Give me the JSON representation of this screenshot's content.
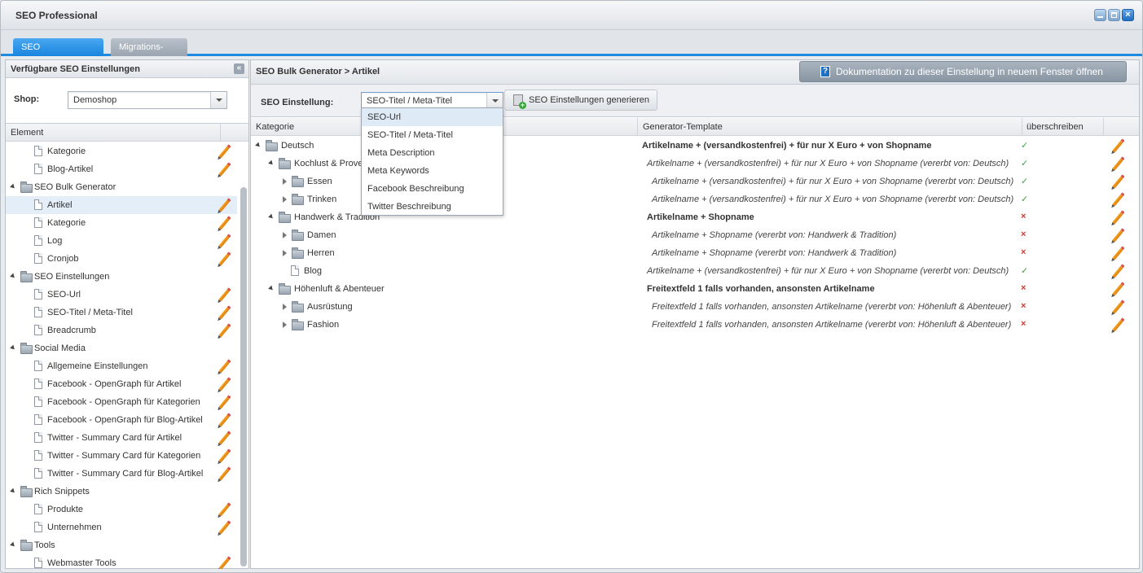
{
  "window": {
    "title": "SEO Professional"
  },
  "tabs": [
    {
      "label": "SEO Einstellungen",
      "active": true
    },
    {
      "label": "Migrations-Tool",
      "active": false
    }
  ],
  "left_panel": {
    "header": "Verfügbare SEO Einstellungen",
    "shop_label": "Shop:",
    "shop_value": "Demoshop",
    "column_header": "Element",
    "tree": [
      {
        "label": "Kategorie",
        "type": "file",
        "level": 2,
        "editable": true
      },
      {
        "label": "Blog-Artikel",
        "type": "file",
        "level": 2,
        "editable": true
      },
      {
        "label": "SEO Bulk Generator",
        "type": "folder",
        "level": 1,
        "editable": false
      },
      {
        "label": "Artikel",
        "type": "file",
        "level": 2,
        "editable": true,
        "selected": true
      },
      {
        "label": "Kategorie",
        "type": "file",
        "level": 2,
        "editable": true
      },
      {
        "label": "Log",
        "type": "file",
        "level": 2,
        "editable": true
      },
      {
        "label": "Cronjob",
        "type": "file",
        "level": 2,
        "editable": true
      },
      {
        "label": "SEO Einstellungen",
        "type": "folder",
        "level": 1,
        "editable": false
      },
      {
        "label": "SEO-Url",
        "type": "file",
        "level": 2,
        "editable": true
      },
      {
        "label": "SEO-Titel / Meta-Titel",
        "type": "file",
        "level": 2,
        "editable": true
      },
      {
        "label": "Breadcrumb",
        "type": "file",
        "level": 2,
        "editable": true
      },
      {
        "label": "Social Media",
        "type": "folder",
        "level": 1,
        "editable": false
      },
      {
        "label": "Allgemeine Einstellungen",
        "type": "file",
        "level": 2,
        "editable": true
      },
      {
        "label": "Facebook - OpenGraph für Artikel",
        "type": "file",
        "level": 2,
        "editable": true
      },
      {
        "label": "Facebook - OpenGraph für Kategorien",
        "type": "file",
        "level": 2,
        "editable": true
      },
      {
        "label": "Facebook - OpenGraph für Blog-Artikel",
        "type": "file",
        "level": 2,
        "editable": true
      },
      {
        "label": "Twitter - Summary Card für Artikel",
        "type": "file",
        "level": 2,
        "editable": true
      },
      {
        "label": "Twitter - Summary Card für Kategorien",
        "type": "file",
        "level": 2,
        "editable": true
      },
      {
        "label": "Twitter - Summary Card für Blog-Artikel",
        "type": "file",
        "level": 2,
        "editable": true
      },
      {
        "label": "Rich Snippets",
        "type": "folder",
        "level": 1,
        "editable": false
      },
      {
        "label": "Produkte",
        "type": "file",
        "level": 2,
        "editable": true
      },
      {
        "label": "Unternehmen",
        "type": "file",
        "level": 2,
        "editable": true
      },
      {
        "label": "Tools",
        "type": "folder",
        "level": 1,
        "editable": false
      },
      {
        "label": "Webmaster Tools",
        "type": "file",
        "level": 2,
        "editable": true
      }
    ]
  },
  "right_panel": {
    "breadcrumb": "SEO Bulk Generator > Artikel",
    "doc_button": "Dokumentation zu dieser Einstellung in neuem Fenster öffnen",
    "setting_label": "SEO Einstellung:",
    "setting_value": "SEO-Titel / Meta-Titel",
    "generate_button": "SEO Einstellungen generieren",
    "columns": {
      "kategorie": "Kategorie",
      "template": "Generator-Template",
      "overwrite": "überschreiben"
    },
    "rows": [
      {
        "label": "Deutsch",
        "depth": 0,
        "toggle": "expanded",
        "icon": "folder",
        "template": "Artikelname + (versandkostenfrei) + für nur X Euro + von Shopname",
        "inherited": false,
        "overwrite": true
      },
      {
        "label": "Kochlust & Provenienz",
        "depth": 1,
        "toggle": "expanded",
        "icon": "folder",
        "template": "Artikelname + (versandkostenfrei) + für nur X Euro + von Shopname (vererbt von: Deutsch)",
        "inherited": true,
        "overwrite": true
      },
      {
        "label": "Essen",
        "depth": 2,
        "toggle": "collapsed",
        "icon": "folder",
        "template": "Artikelname + (versandkostenfrei) + für nur X Euro + von Shopname (vererbt von: Deutsch)",
        "inherited": true,
        "overwrite": true
      },
      {
        "label": "Trinken",
        "depth": 2,
        "toggle": "collapsed",
        "icon": "folder",
        "template": "Artikelname + (versandkostenfrei) + für nur X Euro + von Shopname (vererbt von: Deutsch)",
        "inherited": true,
        "overwrite": true
      },
      {
        "label": "Handwerk & Tradition",
        "depth": 1,
        "toggle": "expanded",
        "icon": "folder",
        "template": "Artikelname + Shopname",
        "inherited": false,
        "overwrite": false
      },
      {
        "label": "Damen",
        "depth": 2,
        "toggle": "collapsed",
        "icon": "folder",
        "template": "Artikelname + Shopname (vererbt von: Handwerk & Tradition)",
        "inherited": true,
        "overwrite": false
      },
      {
        "label": "Herren",
        "depth": 2,
        "toggle": "collapsed",
        "icon": "folder",
        "template": "Artikelname + Shopname (vererbt von: Handwerk & Tradition)",
        "inherited": true,
        "overwrite": false
      },
      {
        "label": "Blog",
        "depth": 1,
        "toggle": "none",
        "icon": "file",
        "template": "Artikelname + (versandkostenfrei) + für nur X Euro + von Shopname (vererbt von: Deutsch)",
        "inherited": true,
        "overwrite": true
      },
      {
        "label": "Höhenluft & Abenteuer",
        "depth": 1,
        "toggle": "expanded",
        "icon": "folder",
        "template": "Freitextfeld 1 falls vorhanden, ansonsten Artikelname",
        "inherited": false,
        "overwrite": false
      },
      {
        "label": "Ausrüstung",
        "depth": 2,
        "toggle": "collapsed",
        "icon": "folder",
        "template": "Freitextfeld 1 falls vorhanden, ansonsten Artikelname (vererbt von: Höhenluft & Abenteuer)",
        "inherited": true,
        "overwrite": false
      },
      {
        "label": "Fashion",
        "depth": 2,
        "toggle": "collapsed",
        "icon": "folder",
        "template": "Freitextfeld 1 falls vorhanden, ansonsten Artikelname (vererbt von: Höhenluft & Abenteuer)",
        "inherited": true,
        "overwrite": false
      }
    ],
    "dropdown_options": [
      "SEO-Url",
      "SEO-Titel / Meta-Titel",
      "Meta Description",
      "Meta Keywords",
      "Facebook Beschreibung",
      "Twitter Beschreibung"
    ],
    "dropdown_highlighted": 0
  },
  "colors": {
    "accent": "#1f8be0",
    "check": "#3aa53a",
    "cross": "#d9362e"
  },
  "icons": {
    "edit": "pencil-icon",
    "folder": "folder-icon",
    "file": "file-icon",
    "check": "checkmark-icon",
    "cross": "cross-icon"
  }
}
